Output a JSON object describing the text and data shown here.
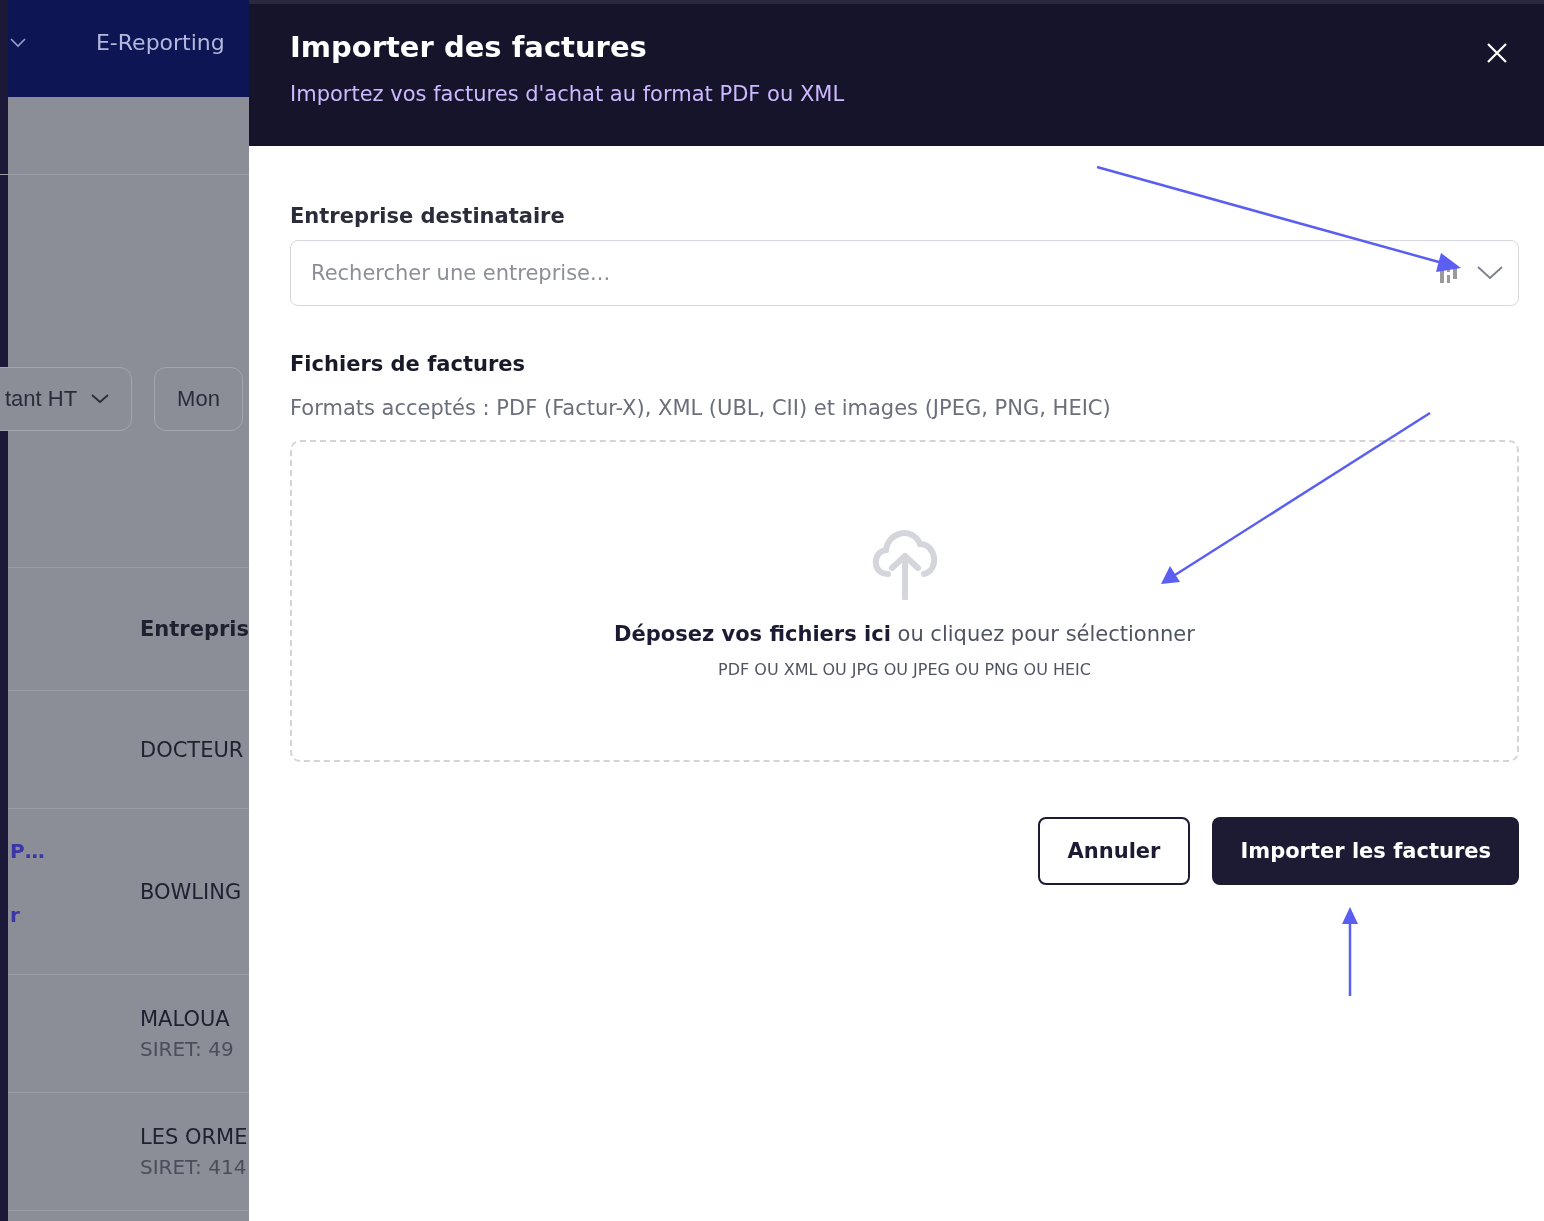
{
  "background": {
    "nav_item": "E-Reporting",
    "filters": [
      "tant HT",
      "Mon"
    ],
    "table_header": "Entrepris",
    "rows": [
      {
        "name": "DOCTEUR"
      },
      {
        "name": "BOWLING",
        "side_links": [
          "P…",
          "r"
        ]
      },
      {
        "name": "MALOUA",
        "siret": "SIRET: 49"
      },
      {
        "name": "LES ORME",
        "siret": "SIRET: 414"
      }
    ]
  },
  "modal": {
    "title": "Importer des factures",
    "subtitle": "Importez vos factures d'achat au format PDF ou XML",
    "company_label": "Entreprise destinataire",
    "company_placeholder": "Rechercher une entreprise...",
    "files_label": "Fichiers de factures",
    "files_hint": "Formats acceptés : PDF (Factur-X), XML (UBL, CII) et images (JPEG, PNG, HEIC)",
    "drop_text": "**Déposez vos fichiers ici** ou cliquez pour sélectionner",
    "drop_formats": "PDF OU XML OU JPG OU JPEG OU PNG OU HEIC",
    "buttons": [
      {
        "label": "Annuler",
        "kind": "secondary"
      },
      {
        "label": "Importer les factures",
        "kind": "primary"
      }
    ]
  }
}
